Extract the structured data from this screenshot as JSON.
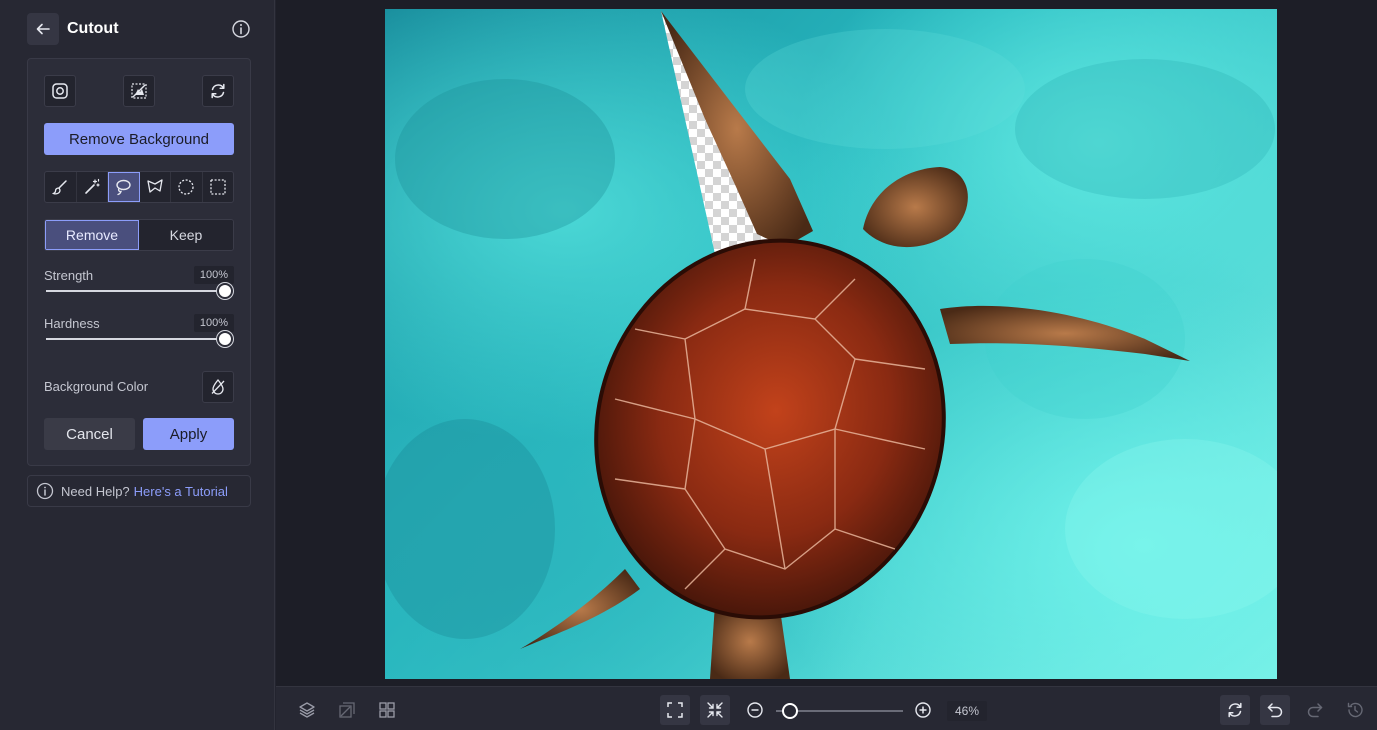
{
  "header": {
    "title": "Cutout"
  },
  "panel": {
    "remove_background_label": "Remove Background",
    "mode": {
      "remove_label": "Remove",
      "keep_label": "Keep",
      "selected": "Remove"
    },
    "strength": {
      "label": "Strength",
      "value": "100%"
    },
    "hardness": {
      "label": "Hardness",
      "value": "100%"
    },
    "background_color_label": "Background Color",
    "cancel_label": "Cancel",
    "apply_label": "Apply",
    "active_tool": "lasso"
  },
  "help": {
    "prefix": "Need Help?",
    "link": "Here's a Tutorial"
  },
  "zoom": {
    "value": "46%",
    "fraction": 0.1
  },
  "colors": {
    "accent": "#8c9dfa",
    "sidebar": "#272833",
    "canvas": "#1d1e27"
  }
}
